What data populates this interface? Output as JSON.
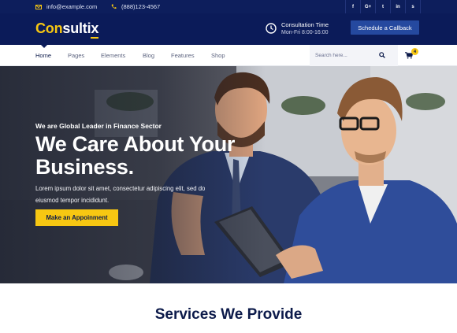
{
  "topbar": {
    "email": "info@example.com",
    "phone": "(888)123-4567",
    "social": [
      "f",
      "G+",
      "t",
      "in",
      "s"
    ],
    "social_icons": [
      "facebook-icon",
      "google-plus-icon",
      "twitter-icon",
      "linkedin-icon",
      "skype-icon"
    ]
  },
  "brand": {
    "logo_part1": "Con",
    "logo_part2": "sultix",
    "consult_title": "Consultation Time",
    "consult_hours": "Mon-Fri 8:00-16:00",
    "callback_label": "Schedule a Callback"
  },
  "nav": {
    "items": [
      "Home",
      "Pages",
      "Elements",
      "Blog",
      "Features",
      "Shop"
    ],
    "active": "Home",
    "search_placeholder": "Search here...",
    "cart_count": "4"
  },
  "hero": {
    "tag": "We are Global Leader in Finance Sector",
    "title": "We Care About Your Business.",
    "desc": "Lorem ipsum dolor sit amet, consectetur adipiscing elit, sed do eiusmod tempor incididunt.",
    "button": "Make an Appoinment"
  },
  "services": {
    "title": "Services We Provide"
  },
  "colors": {
    "navy": "#0b1b59",
    "accent_yellow": "#f7c712",
    "button_blue": "#25499f"
  }
}
